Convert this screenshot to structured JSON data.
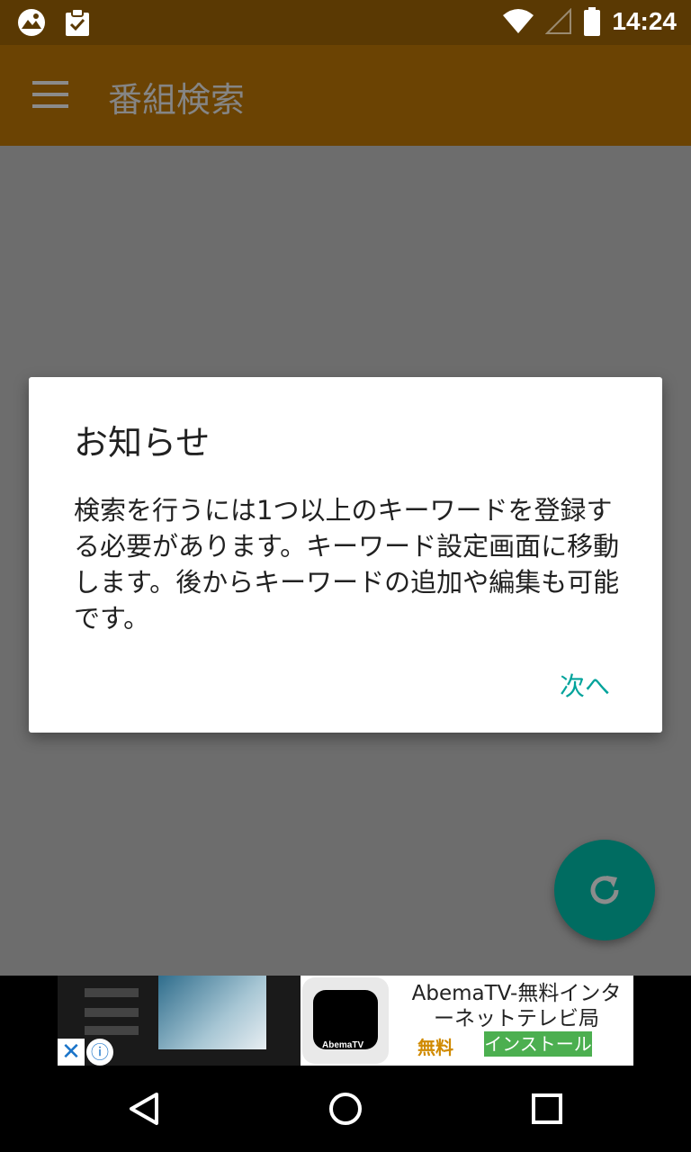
{
  "status_bar": {
    "time": "14:24",
    "icons": [
      "app-notification-icon",
      "clipboard-check-icon",
      "wifi-icon",
      "signal-icon",
      "battery-icon"
    ]
  },
  "app_bar": {
    "title": "番組検索",
    "background": "#6b4303"
  },
  "dialog": {
    "title": "お知らせ",
    "message": "検索を行うには1つ以上のキーワードを登録する必要があります。キーワード設定画面に移動します。後からキーワードの追加や編集も可能です。",
    "next_label": "次へ",
    "accent": "#00a39b"
  },
  "fab": {
    "icon": "refresh-icon",
    "color": "#006c61"
  },
  "ad": {
    "text": "AbemaTV-無料インターネットテレビ局",
    "free_label": "無料",
    "install_label": "インストール",
    "app_icon_brand": "AbemaTV",
    "close_symbol": "✕",
    "info_symbol": "ⓘ"
  },
  "nav_bar": {
    "buttons": [
      "back-icon",
      "home-icon",
      "recents-icon"
    ]
  }
}
